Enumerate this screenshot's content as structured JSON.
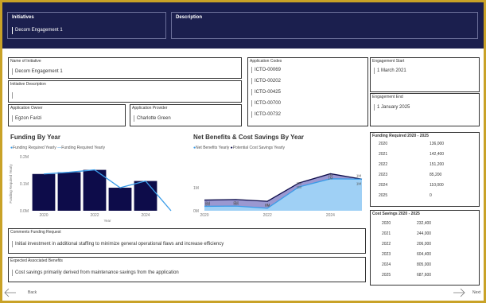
{
  "banner": {
    "initiatives_label": "Initiatives",
    "initiatives_value": "Decom Engagement 1",
    "description_label": "Description"
  },
  "fields": {
    "name_label": "Name of Initiative",
    "name_value": "Decom Engagement 1",
    "desc_label": "Initiative Description",
    "owner_label": "Application Owner",
    "owner_value": "Egzon Farizi",
    "provider_label": "Application Provider",
    "provider_value": "Charlotte Green",
    "codes_label": "Application Codes",
    "codes": [
      "ICTO-00069",
      "ICTO-00202",
      "ICTO-00425",
      "ICTO-00700",
      "ICTO-00732"
    ],
    "start_label": "Engagement Start",
    "start_value": "1 March 2021",
    "end_label": "Engagement End",
    "end_value": "1 January 2025",
    "comments_label": "Comments Funding Request",
    "comments_value": "Initial investment in additional staffing to minimize general operational flaws and increase efficiency",
    "benefits_label": "Expected Associated Benefits",
    "benefits_value": "Cost savings primarily derived from maintenance savings from the application"
  },
  "funding_table": {
    "title": "Funding Required 2020 - 2025",
    "rows": [
      {
        "year": "2020",
        "value": "136,000"
      },
      {
        "year": "2021",
        "value": "142,400"
      },
      {
        "year": "2022",
        "value": "151,200"
      },
      {
        "year": "2023",
        "value": "85,200"
      },
      {
        "year": "2024",
        "value": "110,000"
      },
      {
        "year": "2025",
        "value": "0"
      }
    ]
  },
  "savings_table": {
    "title": "Cost Savings 2020 - 2025",
    "rows": [
      {
        "year": "2020",
        "value": "232,400"
      },
      {
        "year": "2021",
        "value": "244,000"
      },
      {
        "year": "2022",
        "value": "206,000"
      },
      {
        "year": "2023",
        "value": "604,400"
      },
      {
        "year": "2024",
        "value": "805,000"
      },
      {
        "year": "2025",
        "value": "687,600"
      }
    ]
  },
  "nav": {
    "back": "Back",
    "next": "Next"
  },
  "colors": {
    "navy": "#0d0c4a",
    "blue": "#3b9ce8",
    "banner": "#1b1f4e",
    "frame": "#c9a227"
  },
  "chart_data": [
    {
      "type": "bar",
      "title": "Funding By Year",
      "legend": [
        "Funding Required Yearly",
        "Funding Required Yearly"
      ],
      "ylabel": "Funding Required Yearly",
      "xlabel": "Year",
      "yticks": [
        "0.2M",
        "0.1M",
        "0.0M"
      ],
      "xticks": [
        "2020",
        "2022",
        "2024"
      ],
      "categories": [
        "2020",
        "2021",
        "2022",
        "2023",
        "2024",
        "2025"
      ],
      "series": [
        {
          "name": "Funding Required Yearly",
          "kind": "bar",
          "values": [
            136000,
            142400,
            151200,
            85200,
            110000,
            0
          ]
        },
        {
          "name": "Funding Required Yearly",
          "kind": "line",
          "values": [
            136000,
            142400,
            151200,
            85200,
            110000,
            0
          ]
        }
      ],
      "ylim": [
        0,
        200000
      ]
    },
    {
      "type": "area",
      "title": "Net Benefits & Cost Savings By Year",
      "legend": [
        "Net Benefits Yearly",
        "Potential Cost Savings Yearly"
      ],
      "yticks": [
        "1M",
        "0M"
      ],
      "xticks": [
        "2020",
        "2022",
        "2024"
      ],
      "categories": [
        "2020",
        "2021",
        "2022",
        "2023",
        "2024",
        "2025"
      ],
      "series": [
        {
          "name": "Net Benefits Yearly",
          "values": [
            96400,
            101600,
            54800,
            519200,
            695000,
            687600
          ]
        },
        {
          "name": "Potential Cost Savings Yearly",
          "values": [
            232400,
            244000,
            206000,
            604400,
            805000,
            687600
          ]
        }
      ],
      "data_labels": [
        "0M",
        "0M",
        "0M",
        "1M",
        "1M",
        "1M",
        "0M",
        "0M",
        "0M",
        "1M",
        "1M",
        "1M"
      ],
      "ylim": [
        0,
        1000000
      ]
    }
  ]
}
